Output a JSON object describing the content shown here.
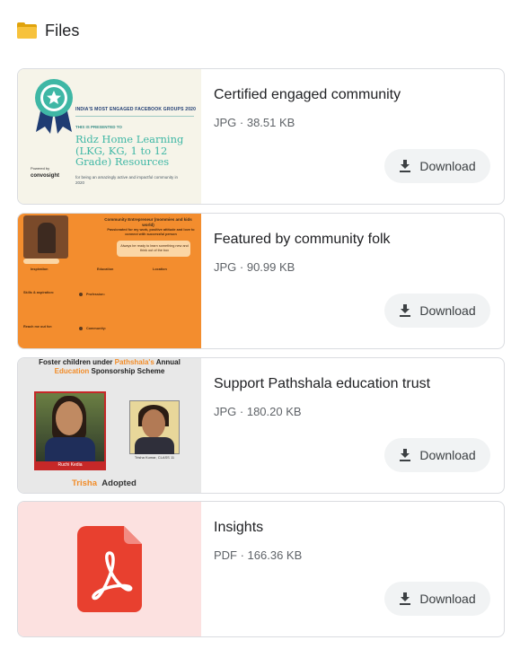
{
  "header": {
    "icon": "folder-icon",
    "title": "Files"
  },
  "files": [
    {
      "name": "Certified engaged community",
      "meta": "JPG · 38.51 KB",
      "download_label": "Download",
      "thumb": {
        "kind": "certificate",
        "heading": "INDIA'S MOST ENGAGED FACEBOOK GROUPS 2020",
        "presented": "THIS IS PRESENTED TO",
        "recipient": "Ridz Home Learning (LKG, KG, 1 to 12 Grade) Resources",
        "reason": "for being an amazingly active and impactful community in 2020",
        "powered": "Powered by",
        "brand": "convosight"
      }
    },
    {
      "name": "Featured by community folk",
      "meta": "JPG · 90.99 KB",
      "download_label": "Download",
      "thumb": {
        "kind": "feature",
        "title": "Community Entrepreneur (mommies and kids world)",
        "tagline": "Passionated for my work, positive attitude and love to connect with successful person",
        "quote": "Always be ready to learn something new and think out of the box",
        "inspiration_label": "Inspiration",
        "education_label": "Education",
        "location_label": "Location",
        "skills_label": "Skills & aspiration:",
        "reach_label": "Reach me out for:",
        "profession_label": "Profession:",
        "community_label": "Community:"
      }
    },
    {
      "name": "Support Pathshala education trust",
      "meta": "JPG · 180.20 KB",
      "download_label": "Download",
      "thumb": {
        "kind": "sponsorship",
        "line1a": "Foster children under ",
        "line1b": "Pathshala's",
        "line1c": " Annual",
        "line2a": "Education",
        "line2b": " Sponsorship Scheme",
        "person1": "Ruchi Kedia",
        "person2": "Trisha Kumar, CLASS 11",
        "footer_a": "Trisha",
        "footer_b": "Adopted"
      }
    },
    {
      "name": "Insights",
      "meta": "PDF · 166.36 KB",
      "download_label": "Download",
      "thumb": {
        "kind": "pdf-file-icon"
      }
    }
  ],
  "colors": {
    "card_border": "#dadce0",
    "button_bg": "#f1f3f4",
    "meta_text": "#5f6368",
    "pdf_red": "#e8402f",
    "pdf_thumb_bg": "#fce1e0"
  }
}
